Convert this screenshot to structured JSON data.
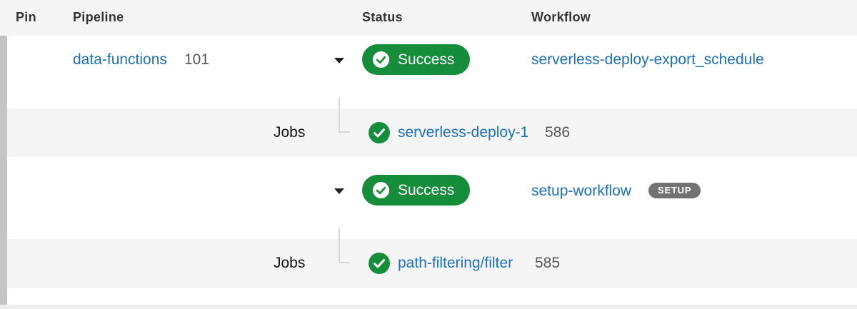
{
  "columns": {
    "pin": "Pin",
    "pipeline": "Pipeline",
    "status": "Status",
    "workflow": "Workflow"
  },
  "pipeline": {
    "name": "data-functions",
    "number": "101"
  },
  "workflows": [
    {
      "status_label": "Success",
      "status_icon": "check-circle-icon",
      "name": "serverless-deploy-export_schedule",
      "jobs_label": "Jobs",
      "job": {
        "name": "serverless-deploy-1",
        "number": "586",
        "icon": "check-circle-icon"
      }
    },
    {
      "status_label": "Success",
      "status_icon": "check-circle-icon",
      "name": "setup-workflow",
      "badge": "SETUP",
      "jobs_label": "Jobs",
      "job": {
        "name": "path-filtering/filter",
        "number": "585",
        "icon": "check-circle-icon"
      }
    }
  ],
  "colors": {
    "success": "#168d3b",
    "link": "#1a6fbf",
    "badge": "#727272"
  }
}
